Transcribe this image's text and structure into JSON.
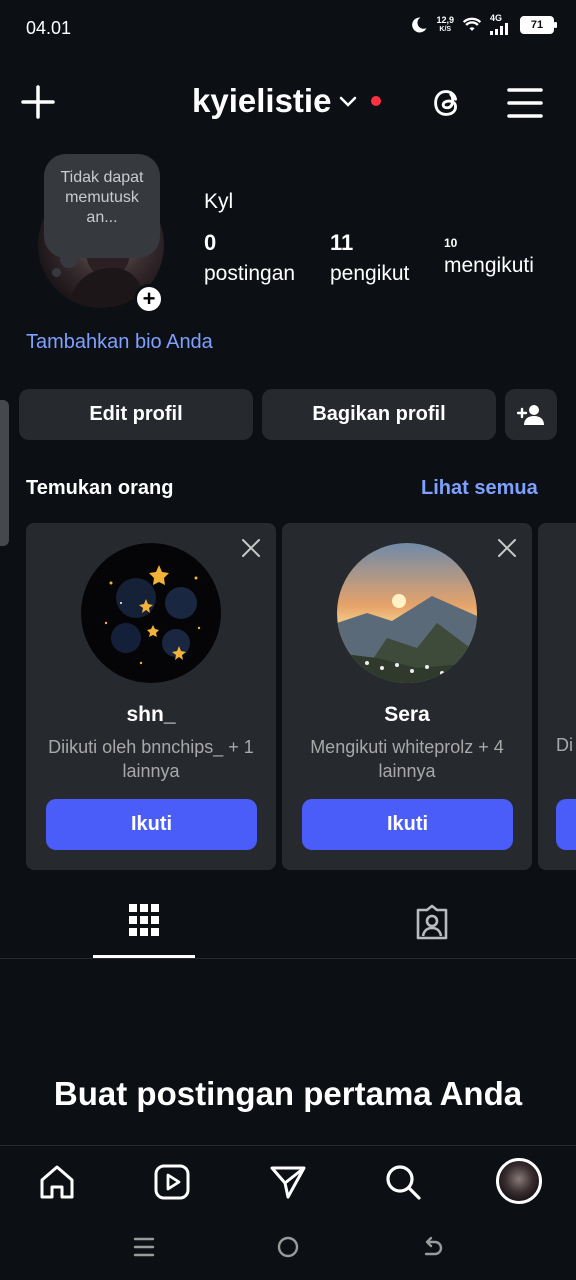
{
  "status_bar": {
    "time": "04.01",
    "net_speed_value": "12,9",
    "net_speed_unit": "K/S",
    "network_type": "4G",
    "battery": "71"
  },
  "header": {
    "username": "kyielistie"
  },
  "profile": {
    "note": "Tidak dapat memutusk an...",
    "display_name": "Kyl",
    "stats": [
      {
        "value": "0",
        "label": "postingan"
      },
      {
        "value": "11",
        "label": "pengikut"
      },
      {
        "value": "10",
        "label": "mengikuti"
      }
    ],
    "add_bio": "Tambahkan bio Anda"
  },
  "actions": {
    "edit_profile": "Edit profil",
    "share_profile": "Bagikan profil"
  },
  "discover": {
    "title": "Temukan orang",
    "see_all": "Lihat semua",
    "cards": [
      {
        "name": "shn_",
        "subtitle": "Diikuti oleh bnnchips_ + 1 lainnya",
        "button": "Ikuti"
      },
      {
        "name": "Sera",
        "subtitle": "Mengikuti whiteprolz + 4 lainnya",
        "button": "Ikuti"
      },
      {
        "name": "",
        "subtitle": "Di",
        "button": ""
      }
    ]
  },
  "empty_state": {
    "title": "Buat postingan pertama Anda"
  },
  "colors": {
    "background": "#0c1014",
    "surface": "#262a2f",
    "accent_blue": "#4a5df9",
    "link_blue": "#7ea0ff",
    "notification_red": "#ff3040"
  }
}
